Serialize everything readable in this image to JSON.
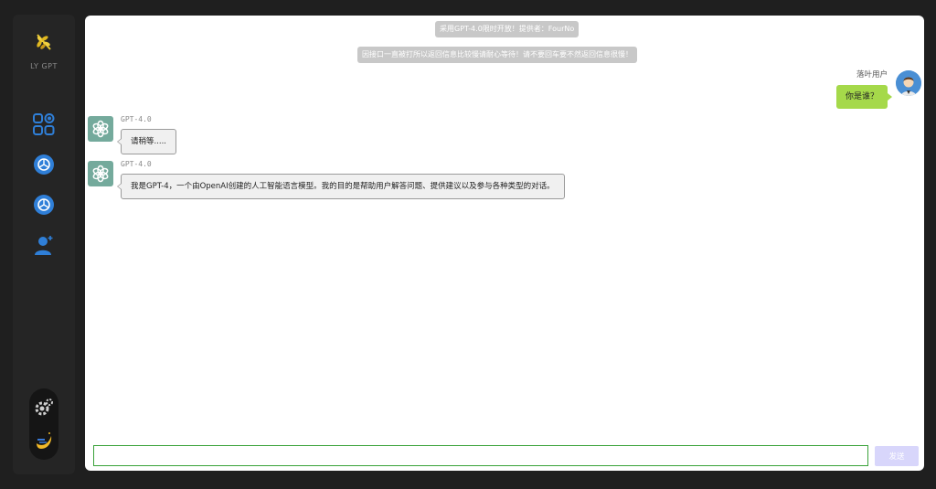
{
  "sidebar": {
    "logo_text": "LY GPT",
    "logo_icon": "wheat-leaf-icon",
    "items": [
      {
        "icon": "apps-grid-icon"
      },
      {
        "icon": "openai-chat-icon"
      },
      {
        "icon": "openai-chat-icon"
      },
      {
        "icon": "user-add-icon"
      }
    ],
    "bottom": [
      {
        "icon": "settings-gear-icon"
      },
      {
        "icon": "moon-theme-icon"
      }
    ]
  },
  "chat": {
    "notices": [
      "采用GPT-4.0限时开放！提供者：FourNo",
      "因接口一直被打所以返回信息比较慢请耐心等待！请不要回车要不然返回信息很慢！"
    ],
    "user": {
      "name": "落叶用户",
      "message": "你是谁？"
    },
    "bot_messages": [
      {
        "name": "GPT-4.0",
        "text": "请稍等....."
      },
      {
        "name": "GPT-4.0",
        "text": "我是GPT-4，一个由OpenAI创建的人工智能语言模型。我的目的是帮助用户解答问题、提供建议以及参与各种类型的对话。"
      }
    ]
  },
  "input": {
    "value": "",
    "send_label": "发送"
  },
  "colors": {
    "accent_green": "#a5d94a",
    "bot_avatar": "#74aa9c",
    "send_button": "#d8d6fb",
    "nav_icon": "#2f7fd8"
  }
}
